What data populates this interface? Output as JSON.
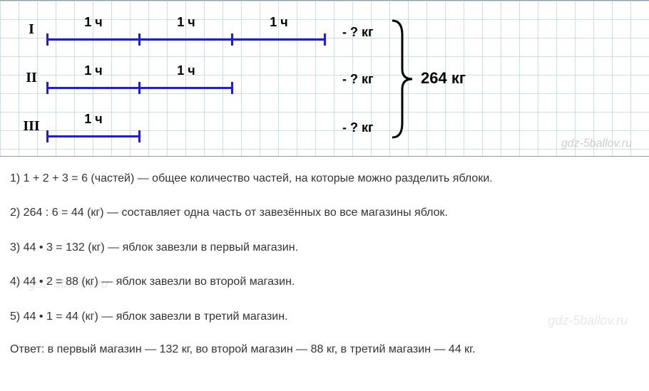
{
  "diagram": {
    "rows": [
      {
        "roman": "I",
        "segments": [
          "1 ч",
          "1 ч",
          "1 ч"
        ],
        "question": "- ? кг"
      },
      {
        "roman": "II",
        "segments": [
          "1 ч",
          "1 ч"
        ],
        "question": "- ? кг"
      },
      {
        "roman": "III",
        "segments": [
          "1 ч"
        ],
        "question": "- ? кг"
      }
    ],
    "total": "264 кг",
    "watermark": "gdz-5ballov.ru"
  },
  "solution": {
    "steps": [
      "1) 1 + 2 + 3 = 6 (частей) — общее количество частей, на которые можно разделить яблоки.",
      "2) 264 : 6 = 44 (кг) — составляет одна часть от завезённых во все магазины яблок.",
      "3) 44 • 3 = 132 (кг) — яблок завезли в первый магазин.",
      "4) 44 • 2 = 88 (кг) — яблок завезли во второй магазин.",
      "5) 44 • 1 = 44 (кг) — яблок завезли в третий магазин."
    ],
    "answer": "Ответ: в первый магазин — 132 кг, во второй магазин — 88 кг, в третий магазин — 44 кг.",
    "watermark": "gdz-5ballov.ru"
  }
}
